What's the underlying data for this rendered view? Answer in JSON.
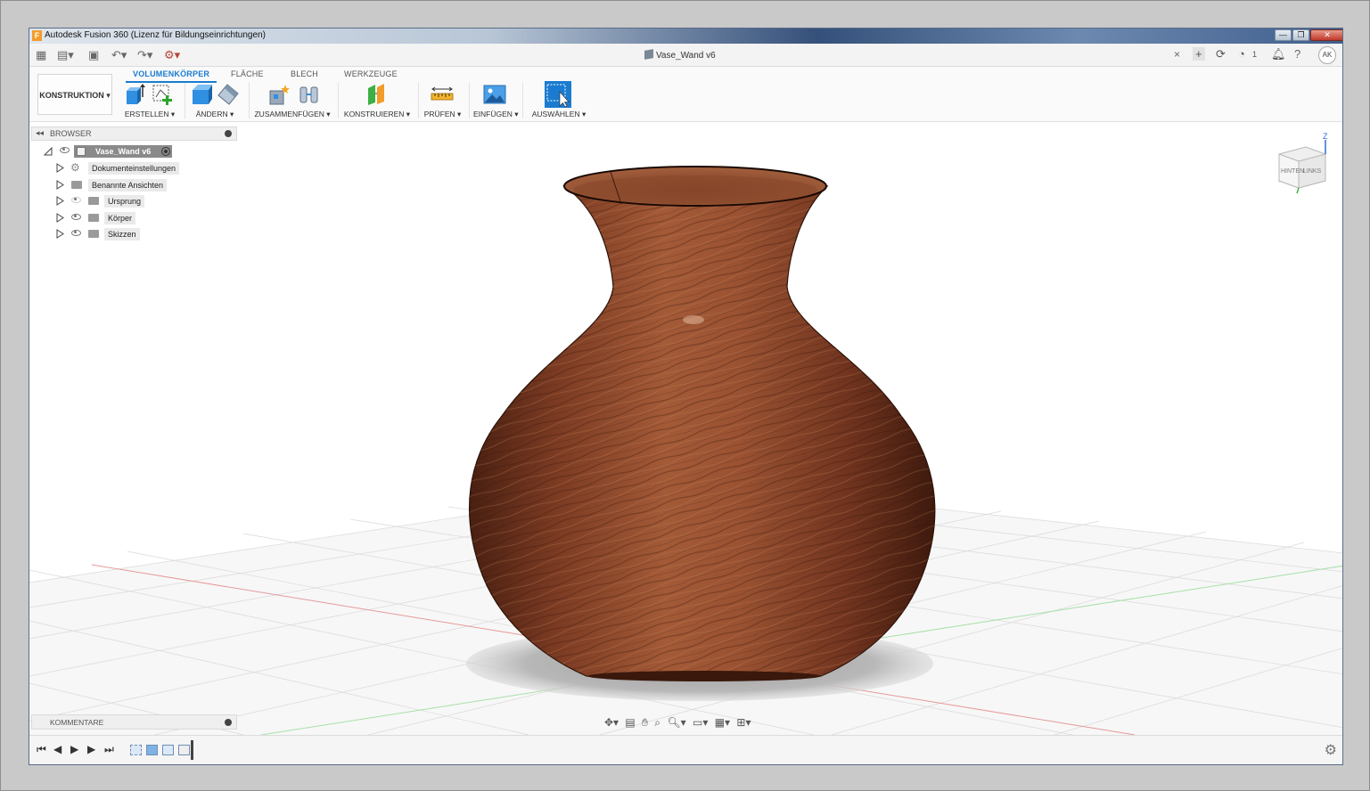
{
  "window": {
    "title": "Autodesk Fusion 360 (Lizenz für Bildungseinrichtungen)",
    "minimize": "—",
    "maximize": "❐",
    "close": "✕"
  },
  "doc_tab": {
    "title": "Vase_Wand v6",
    "close": "×"
  },
  "right_bar": {
    "jobs": "1",
    "user_initials": "AK"
  },
  "ribbon": {
    "workspace": "KONSTRUKTION ▾",
    "tabs": [
      "VOLUMENKÖRPER",
      "FLÄCHE",
      "BLECH",
      "WERKZEUGE"
    ],
    "groups": {
      "erstellen": "ERSTELLEN ▾",
      "aendern": "ÄNDERN ▾",
      "zusammenfuegen": "ZUSAMMENFÜGEN ▾",
      "konstruieren": "KONSTRUIEREN ▾",
      "pruefen": "PRÜFEN ▾",
      "einfuegen": "EINFÜGEN ▾",
      "auswaehlen": "AUSWÄHLEN ▾"
    }
  },
  "browser": {
    "title": "BROWSER",
    "root": "Vase_Wand v6",
    "items": [
      "Dokumenteinstellungen",
      "Benannte Ansichten",
      "Ursprung",
      "Körper",
      "Skizzen"
    ]
  },
  "viewcube": {
    "face_back": "HINTEN",
    "face_left": "LINKS",
    "axis_z": "Z"
  },
  "comments": {
    "title": "KOMMENTARE"
  },
  "colors": {
    "accent": "#1a7bd0",
    "wood_dark": "#5c2a18",
    "wood_mid": "#8a4327",
    "wood_light": "#b46a45"
  }
}
